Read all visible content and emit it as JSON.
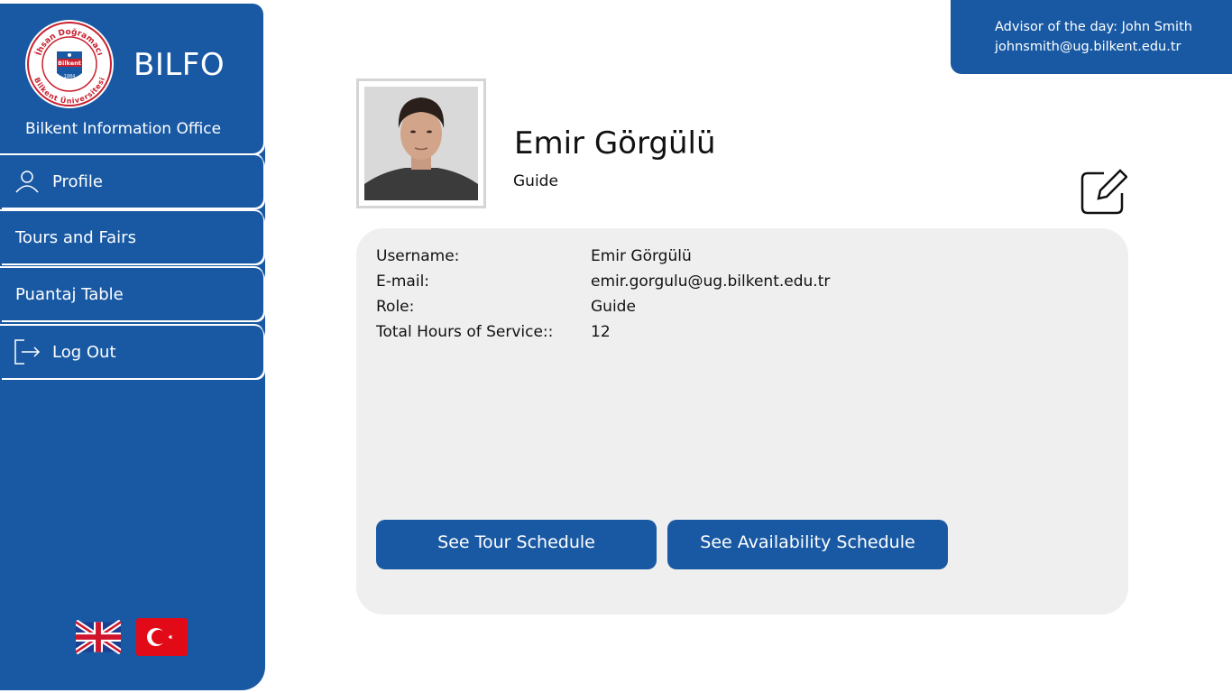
{
  "brand": {
    "name": "BILFO",
    "subtitle": "Bilkent Information Office",
    "logo_text_top": "İhsan Doğramacı",
    "logo_text_bottom": "Bilkent Üniversitesi",
    "logo_center": "Bilkent",
    "logo_year": "1984"
  },
  "nav": {
    "profile": "Profile",
    "tours": "Tours and Fairs",
    "puantaj": "Puantaj Table",
    "logout": "Log Out"
  },
  "advisor": {
    "line1": "Advisor of the day: John Smith",
    "line2": "johnsmith@ug.bilkent.edu.tr"
  },
  "profile": {
    "name": "Emir Görgülü",
    "role": "Guide"
  },
  "info": {
    "username_label": "Username:",
    "username_value": "Emir Görgülü",
    "email_label": "E-mail:",
    "email_value": "emir.gorgulu@ug.bilkent.edu.tr",
    "role_label": "Role:",
    "role_value": "Guide",
    "hours_label": "Total Hours of Service::",
    "hours_value": "12"
  },
  "buttons": {
    "tour_schedule": "See Tour Schedule",
    "availability_schedule": "See Availability Schedule"
  },
  "icons": {
    "profile": "user-icon",
    "logout": "logout-icon",
    "edit": "edit-icon"
  },
  "colors": {
    "primary": "#1959a3",
    "card_bg": "#efefef"
  }
}
